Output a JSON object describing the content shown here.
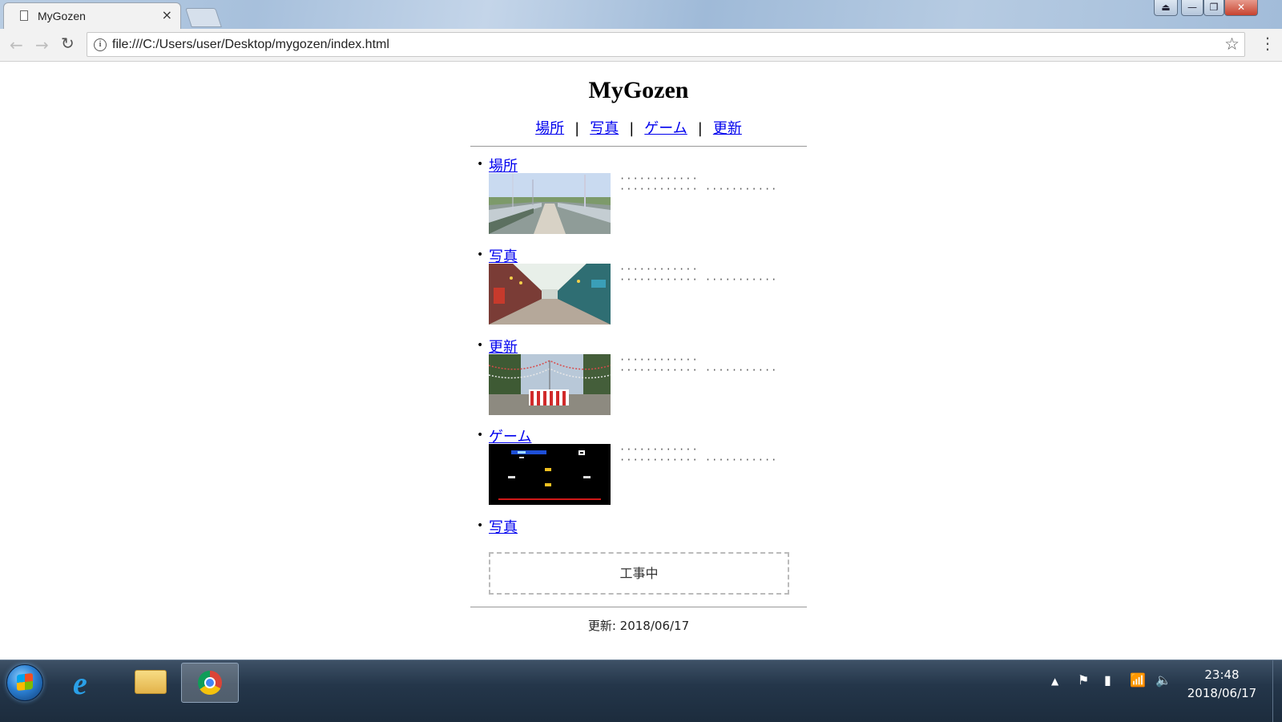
{
  "browser": {
    "tab_title": "MyGozen",
    "tab_close": "×",
    "url": "file:///C:/Users/user/Desktop/mygozen/index.html",
    "window_close": "✕"
  },
  "page": {
    "title": "MyGozen",
    "nav": [
      "場所",
      "写真",
      "ゲーム",
      "更新"
    ],
    "nav_separator": "|",
    "sections": [
      {
        "label": "場所",
        "image": "bridge-walkway-photo"
      },
      {
        "label": "写真",
        "image": "shopping-arcade-photo"
      },
      {
        "label": "更新",
        "image": "festival-stage-photo"
      },
      {
        "label": "ゲーム",
        "image": "retro-game-screenshot"
      },
      {
        "label": "写真"
      }
    ],
    "construction_text": "工事中",
    "updated": "更新: 2018/06/17"
  },
  "taskbar": {
    "apps": [
      "start-orb",
      "internet-explorer",
      "file-explorer",
      "chrome"
    ],
    "clock_time": "23:48",
    "clock_date": "2018/06/17"
  }
}
